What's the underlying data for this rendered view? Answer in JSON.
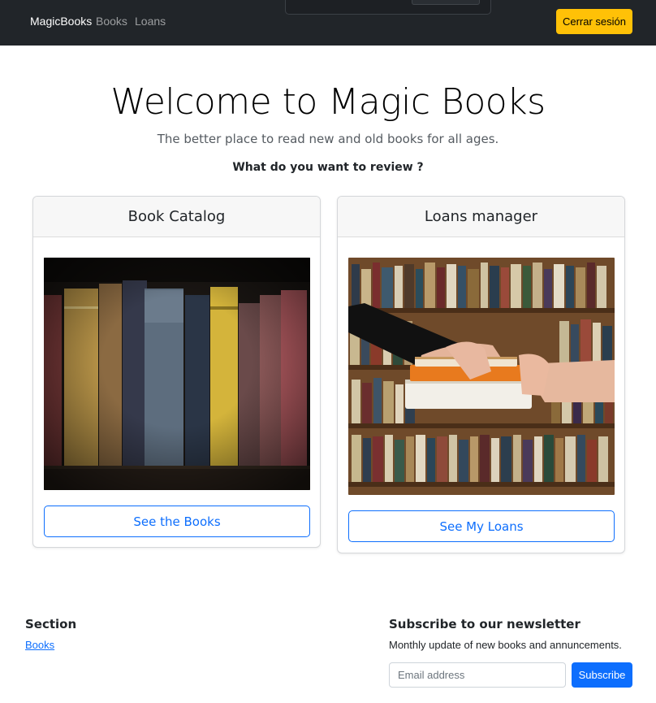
{
  "navbar": {
    "brand": "MagicBooks",
    "links": [
      {
        "label": "Books"
      },
      {
        "label": "Loans"
      }
    ],
    "logout_label": "Cerrar sesión"
  },
  "hero": {
    "title": "Welcome to Magic Books",
    "lead": "The better place to read new and old books for all ages.",
    "question": "What do you want to review ?"
  },
  "cards": [
    {
      "header": "Book Catalog",
      "button": "See the Books"
    },
    {
      "header": "Loans manager",
      "button": "See My Loans"
    }
  ],
  "footer": {
    "section_title": "Section",
    "section_link": "Books",
    "newsletter_title": "Subscribe to our newsletter",
    "newsletter_desc": "Monthly update of new books and annuncements.",
    "email_placeholder": "Email address",
    "subscribe_label": "Subscribe"
  },
  "colors": {
    "navbar_bg": "#212529",
    "warning": "#ffc107",
    "primary": "#0d6efd"
  },
  "images": {
    "catalog": "books-on-shelf-image",
    "loans": "hands-exchanging-books-image"
  }
}
